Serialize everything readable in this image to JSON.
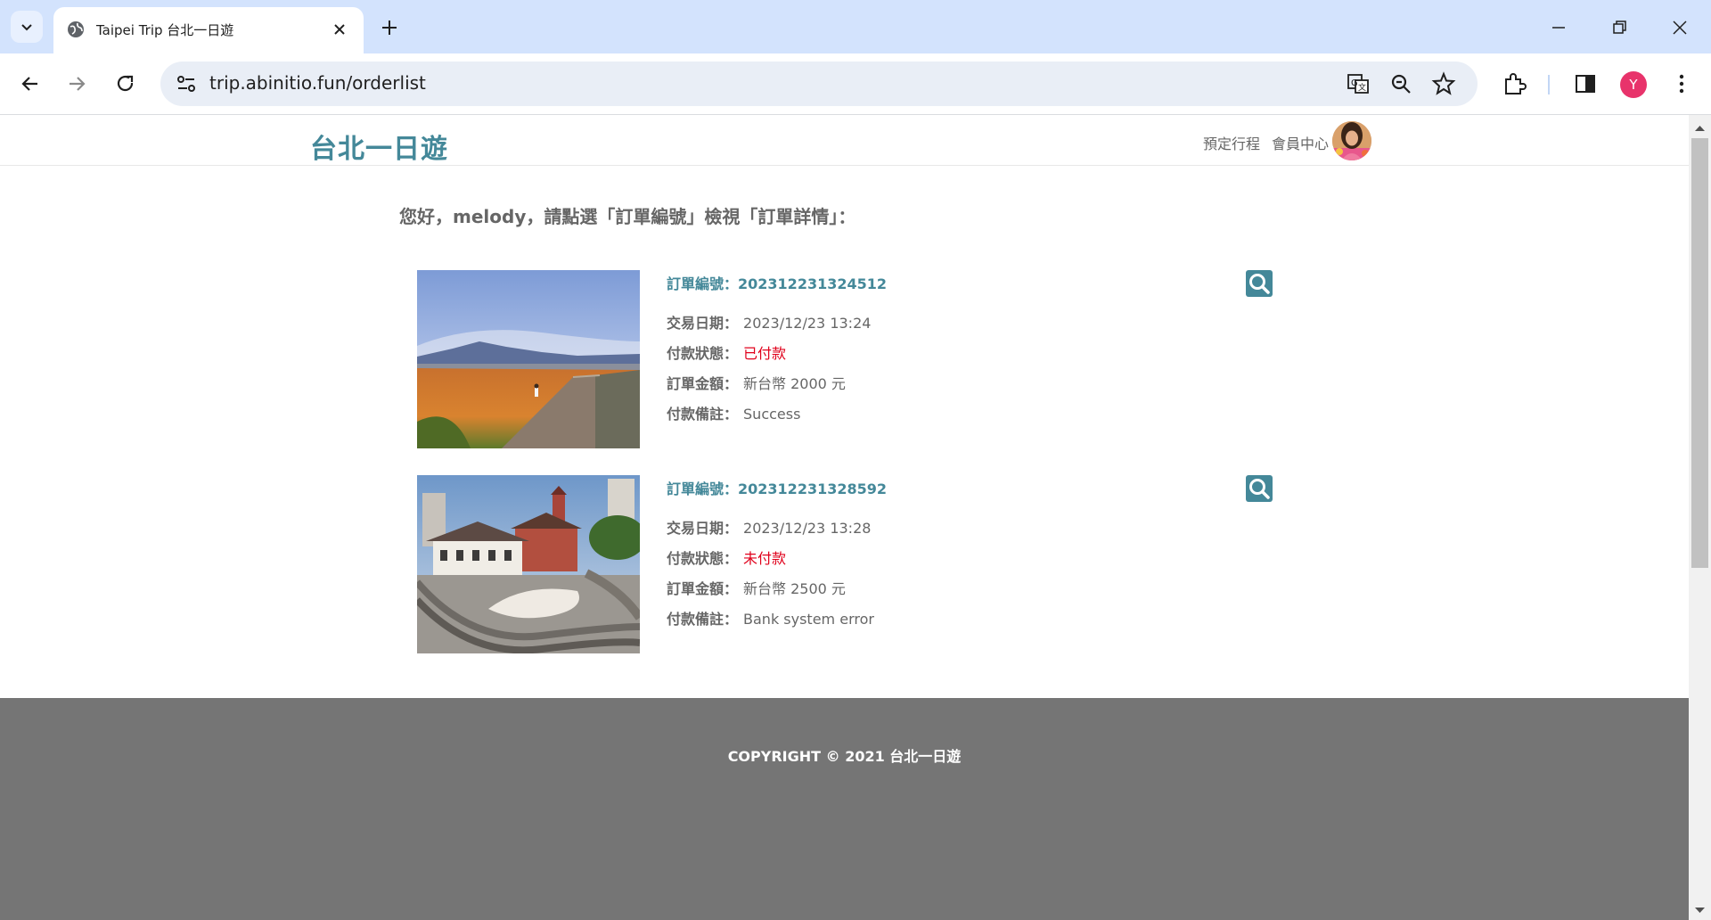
{
  "browser": {
    "tab_title": "Taipei Trip 台北一日遊",
    "url": "trip.abinitio.fun/orderlist",
    "profile_initial": "Y"
  },
  "header": {
    "brand": "台北一日遊",
    "nav_booking": "預定行程",
    "nav_member": "會員中心"
  },
  "greeting": "您好，melody，請點選「訂單編號」檢視「訂單詳情」：",
  "labels": {
    "order_no": "訂單編號：",
    "date": "交易日期：",
    "status": "付款狀態：",
    "amount": "訂單金額：",
    "note": "付款備註："
  },
  "orders": [
    {
      "number": "202312231324512",
      "date": "2023/12/23 13:24",
      "status": "已付款",
      "amount": "新台幣 2000 元",
      "note": "Success",
      "image": "field-road-photo"
    },
    {
      "number": "202312231328592",
      "date": "2023/12/23 13:28",
      "status": "未付款",
      "amount": "新台幣 2500 元",
      "note": "Bank system error",
      "image": "historic-building-photo"
    }
  ],
  "footer": {
    "copyright": "COPYRIGHT © 2021 台北一日遊"
  },
  "colors": {
    "brand": "#448899",
    "status_red": "#e0001b",
    "footer_bg": "#757575",
    "tabbar_bg": "#d3e3fd"
  }
}
